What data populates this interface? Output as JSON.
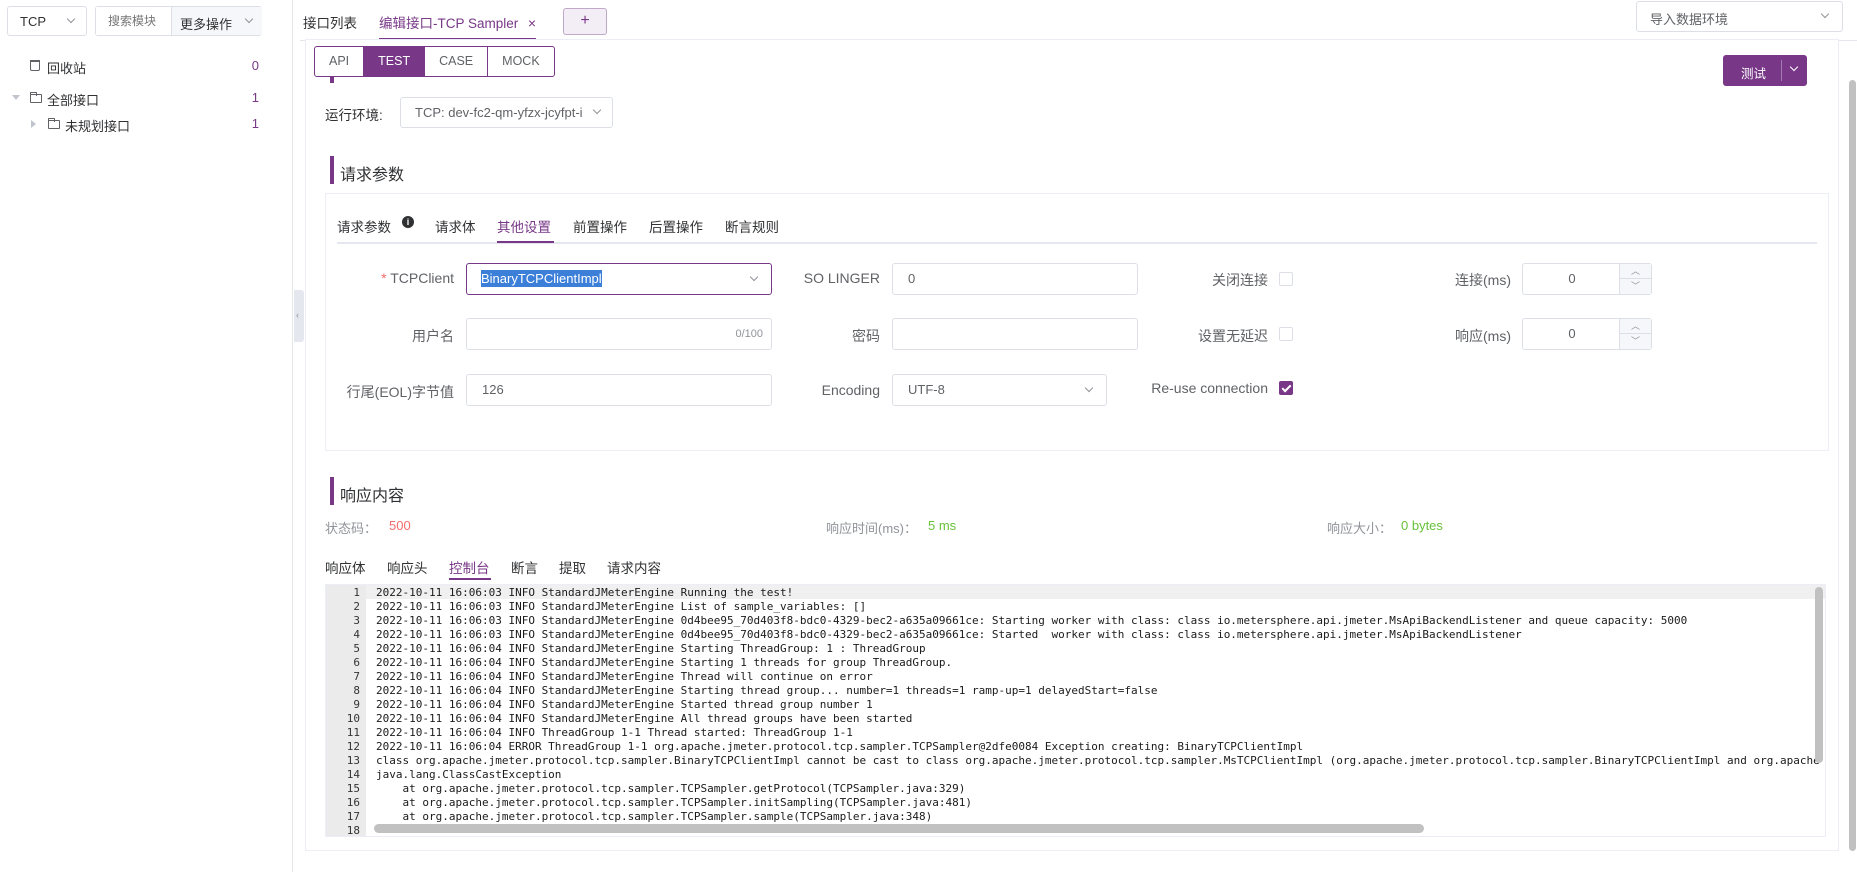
{
  "sidebar": {
    "protocol": "TCP",
    "search_placeholder": "搜索模块",
    "more_ops": "更多操作",
    "tree": [
      {
        "label": "回收站",
        "count": "0"
      },
      {
        "label": "全部接口",
        "count": "1"
      },
      {
        "label": "未规划接口",
        "count": "1"
      }
    ]
  },
  "tabs": {
    "list": "接口列表",
    "active": "编辑接口-TCP Sampler",
    "close": "×",
    "add": "+"
  },
  "env_import": {
    "placeholder": "导入数据环境"
  },
  "mode_tabs": [
    "API",
    "TEST",
    "CASE",
    "MOCK"
  ],
  "test_button": {
    "label": "测试"
  },
  "run_env": {
    "label": "运行环境:",
    "value": "TCP: dev-fc2-qm-yfzx-jcyfpt-i"
  },
  "request": {
    "title": "请求参数",
    "tabs": [
      "请求参数",
      "请求体",
      "其他设置",
      "前置操作",
      "后置操作",
      "断言规则"
    ],
    "active_tab": "其他设置",
    "info_icon": "i",
    "tcp_client": {
      "required": "*",
      "label": "TCPClient",
      "value": "BinaryTCPClientImpl"
    },
    "so_linger": {
      "label": "SO LINGER",
      "value": "0"
    },
    "close_conn": {
      "label": "关闭连接"
    },
    "connect_ms": {
      "label": "连接(ms)",
      "value": "0"
    },
    "username": {
      "label": "用户名",
      "counter": "0/100"
    },
    "password": {
      "label": "密码"
    },
    "no_delay": {
      "label": "设置无延迟"
    },
    "response_ms": {
      "label": "响应(ms)",
      "value": "0"
    },
    "eol": {
      "label": "行尾(EOL)字节值",
      "value": "126"
    },
    "encoding": {
      "label": "Encoding",
      "value": "UTF-8"
    },
    "reuse": {
      "label": "Re-use connection",
      "checked": true
    }
  },
  "response": {
    "title": "响应内容",
    "status_label": "状态码：",
    "status_value": "500",
    "time_label": "响应时间(ms)：",
    "time_value": "5 ms",
    "size_label": "响应大小：",
    "size_value": "0 bytes",
    "tabs": [
      "响应体",
      "响应头",
      "控制台",
      "断言",
      "提取",
      "请求内容"
    ],
    "active_tab": "控制台"
  },
  "console": {
    "lines": [
      "2022-10-11 16:06:03 INFO StandardJMeterEngine Running the test!",
      "2022-10-11 16:06:03 INFO StandardJMeterEngine List of sample_variables: []",
      "2022-10-11 16:06:03 INFO StandardJMeterEngine 0d4bee95_70d403f8-bdc0-4329-bec2-a635a09661ce: Starting worker with class: class io.metersphere.api.jmeter.MsApiBackendListener and queue capacity: 5000",
      "2022-10-11 16:06:03 INFO StandardJMeterEngine 0d4bee95_70d403f8-bdc0-4329-bec2-a635a09661ce: Started  worker with class: class io.metersphere.api.jmeter.MsApiBackendListener",
      "2022-10-11 16:06:04 INFO StandardJMeterEngine Starting ThreadGroup: 1 : ThreadGroup",
      "2022-10-11 16:06:04 INFO StandardJMeterEngine Starting 1 threads for group ThreadGroup.",
      "2022-10-11 16:06:04 INFO StandardJMeterEngine Thread will continue on error",
      "2022-10-11 16:06:04 INFO StandardJMeterEngine Starting thread group... number=1 threads=1 ramp-up=1 delayedStart=false",
      "2022-10-11 16:06:04 INFO StandardJMeterEngine Started thread group number 1",
      "2022-10-11 16:06:04 INFO StandardJMeterEngine All thread groups have been started",
      "2022-10-11 16:06:04 INFO ThreadGroup 1-1 Thread started: ThreadGroup 1-1",
      "2022-10-11 16:06:04 ERROR ThreadGroup 1-1 org.apache.jmeter.protocol.tcp.sampler.TCPSampler@2dfe0084 Exception creating: BinaryTCPClientImpl",
      "class org.apache.jmeter.protocol.tcp.sampler.BinaryTCPClientImpl cannot be cast to class org.apache.jmeter.protocol.tcp.sampler.MsTCPClientImpl (org.apache.jmeter.protocol.tcp.sampler.BinaryTCPClientImpl and org.apache",
      "java.lang.ClassCastException",
      "    at org.apache.jmeter.protocol.tcp.sampler.TCPSampler.getProtocol(TCPSampler.java:329)",
      "    at org.apache.jmeter.protocol.tcp.sampler.TCPSampler.initSampling(TCPSampler.java:481)",
      "    at org.apache.jmeter.protocol.tcp.sampler.TCPSampler.sample(TCPSampler.java:348)",
      ""
    ]
  },
  "colors": {
    "accent": "#783887",
    "error": "#f56c6c",
    "success": "#67c23a"
  }
}
